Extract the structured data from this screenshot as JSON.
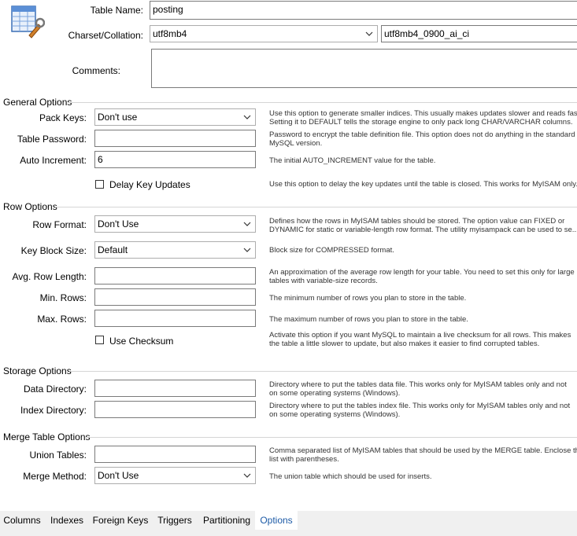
{
  "header": {
    "icon": "table-wrench-icon",
    "table_name_label": "Table Name:",
    "table_name_value": "posting",
    "charset_label": "Charset/Collation:",
    "charset_value": "utf8mb4",
    "collation_value": "utf8mb4_0900_ai_ci",
    "comments_label": "Comments:",
    "comments_value": ""
  },
  "general": {
    "title": "General Options",
    "pack_keys_label": "Pack Keys:",
    "pack_keys_value": "Don't use",
    "pack_keys_desc": [
      "Use this option to generate smaller indices. This usually makes updates slower and reads faster.",
      "Setting it to DEFAULT tells the storage engine to only pack long CHAR/VARCHAR columns."
    ],
    "table_password_label": "Table Password:",
    "table_password_value": "",
    "table_password_desc": [
      "Password to encrypt the table definition file. This option does not do anything in the standard",
      "MySQL version."
    ],
    "auto_increment_label": "Auto Increment:",
    "auto_increment_value": "6",
    "auto_increment_desc": "The initial AUTO_INCREMENT value for the table.",
    "delay_key_label": "Delay Key Updates",
    "delay_key_checked": false,
    "delay_key_desc": "Use this option to delay the key updates until the table is closed. This works for MyISAM only."
  },
  "row": {
    "title": "Row Options",
    "row_format_label": "Row Format:",
    "row_format_value": "Don't Use",
    "row_format_desc": [
      "Defines how the rows in MyISAM tables should be stored. The option value can FIXED or",
      "DYNAMIC for static or variable-length row format. The utility myisampack can be used to se..."
    ],
    "key_block_label": "Key Block Size:",
    "key_block_value": "Default",
    "key_block_desc": "Block size for COMPRESSED format.",
    "avg_row_label": "Avg. Row Length:",
    "avg_row_value": "",
    "avg_row_desc": [
      "An approximation of the average row length for your table. You need to set this only for large",
      "tables with variable-size records."
    ],
    "min_rows_label": "Min. Rows:",
    "min_rows_value": "",
    "min_rows_desc": "The minimum number of rows you plan to store in the table.",
    "max_rows_label": "Max. Rows:",
    "max_rows_value": "",
    "max_rows_desc": "The maximum number of rows you plan to store in the table.",
    "checksum_label": "Use Checksum",
    "checksum_checked": false,
    "checksum_desc": [
      "Activate this option if you want MySQL to maintain a live checksum for all rows. This makes",
      "the table a little slower to update, but also makes it easier to find corrupted tables."
    ]
  },
  "storage": {
    "title": "Storage Options",
    "data_dir_label": "Data Directory:",
    "data_dir_value": "",
    "data_dir_desc": [
      "Directory where to put the tables data file. This works only for MyISAM tables only and not",
      "on some operating systems (Windows)."
    ],
    "index_dir_label": "Index Directory:",
    "index_dir_value": "",
    "index_dir_desc": [
      "Directory where to put the tables index file. This works only for MyISAM tables only and not",
      "on some operating systems (Windows)."
    ]
  },
  "merge": {
    "title": "Merge Table Options",
    "union_label": "Union Tables:",
    "union_value": "",
    "union_desc": [
      "Comma separated list of MyISAM tables that should be used by the MERGE table. Enclose the",
      "list with parentheses."
    ],
    "merge_method_label": "Merge Method:",
    "merge_method_value": "Don't Use",
    "merge_method_desc": "The union table which should be used for inserts."
  },
  "tabs": [
    "Columns",
    "Indexes",
    "Foreign Keys",
    "Triggers",
    "Partitioning",
    "Options"
  ],
  "active_tab": "Options",
  "colors": {
    "accent": "#1c5aa6",
    "tab_bar": "#f0f0f0",
    "group_line": "#d5d5d5"
  }
}
